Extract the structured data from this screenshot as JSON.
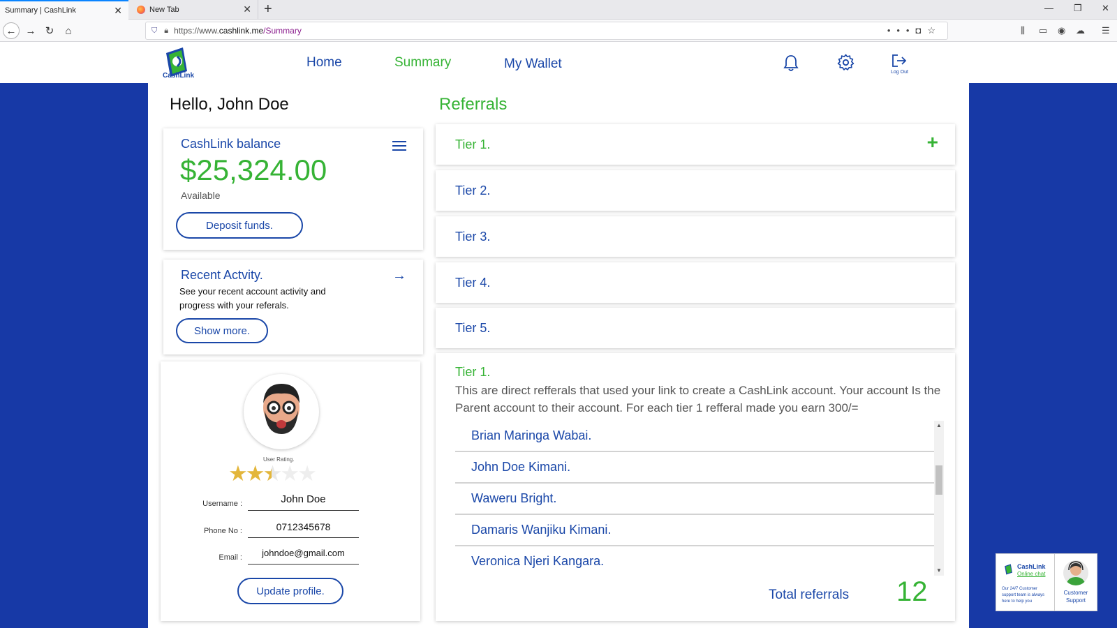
{
  "browser": {
    "tabs": [
      {
        "title": "Summary | CashLink",
        "active": true
      },
      {
        "title": "New Tab",
        "active": false
      }
    ],
    "url": {
      "prefix": "https://www.",
      "domain": "cashlink.me",
      "path": "/Summary"
    }
  },
  "header": {
    "logo_text": "CashLink",
    "nav": {
      "home": "Home",
      "summary": "Summary",
      "wallet": "My Wallet"
    },
    "logout_label": "Log Out"
  },
  "greeting": "Hello, John Doe",
  "balance": {
    "title": "CashLink balance",
    "amount": "$25,324.00",
    "sub": "Available",
    "deposit_label": "Deposit funds."
  },
  "activity": {
    "title": "Recent Actvity.",
    "description": "See your recent account activity and progress with your referals.",
    "button_label": "Show more."
  },
  "profile": {
    "rating_label": "User Rating.",
    "rating": 2.5,
    "rating_max": 5,
    "username_label": "Username :",
    "username": "John Doe",
    "phone_label": "Phone No :",
    "phone": "0712345678",
    "email_label": "Email :",
    "email": "johndoe@gmail.com",
    "update_label": "Update profile."
  },
  "referrals": {
    "title": "Referrals",
    "tiers": [
      "Tier 1.",
      "Tier 2.",
      "Tier 3.",
      "Tier 4.",
      "Tier 5."
    ],
    "detail_title": "Tier 1.",
    "detail_description": "This are direct refferals that used your link to create a CashLink account. Your account Is the Parent account to their account. For each tier 1 refferal made you earn 300/=",
    "list": [
      "Brian Maringa Wabai.",
      "John Doe Kimani.",
      "Waweru Bright.",
      "Damaris Wanjiku Kimani.",
      "Veronica Njeri Kangara."
    ],
    "total_label": "Total referrals",
    "total_value": "12"
  },
  "chat": {
    "brand": "CashLink",
    "brand_sub": "Online chat",
    "text": "Our 24/7 Customer support team is always here to help you",
    "support": "Customer Support"
  },
  "colors": {
    "brand_blue": "#1a47a8",
    "brand_green": "#36b335",
    "background_blue": "#1739a6"
  }
}
